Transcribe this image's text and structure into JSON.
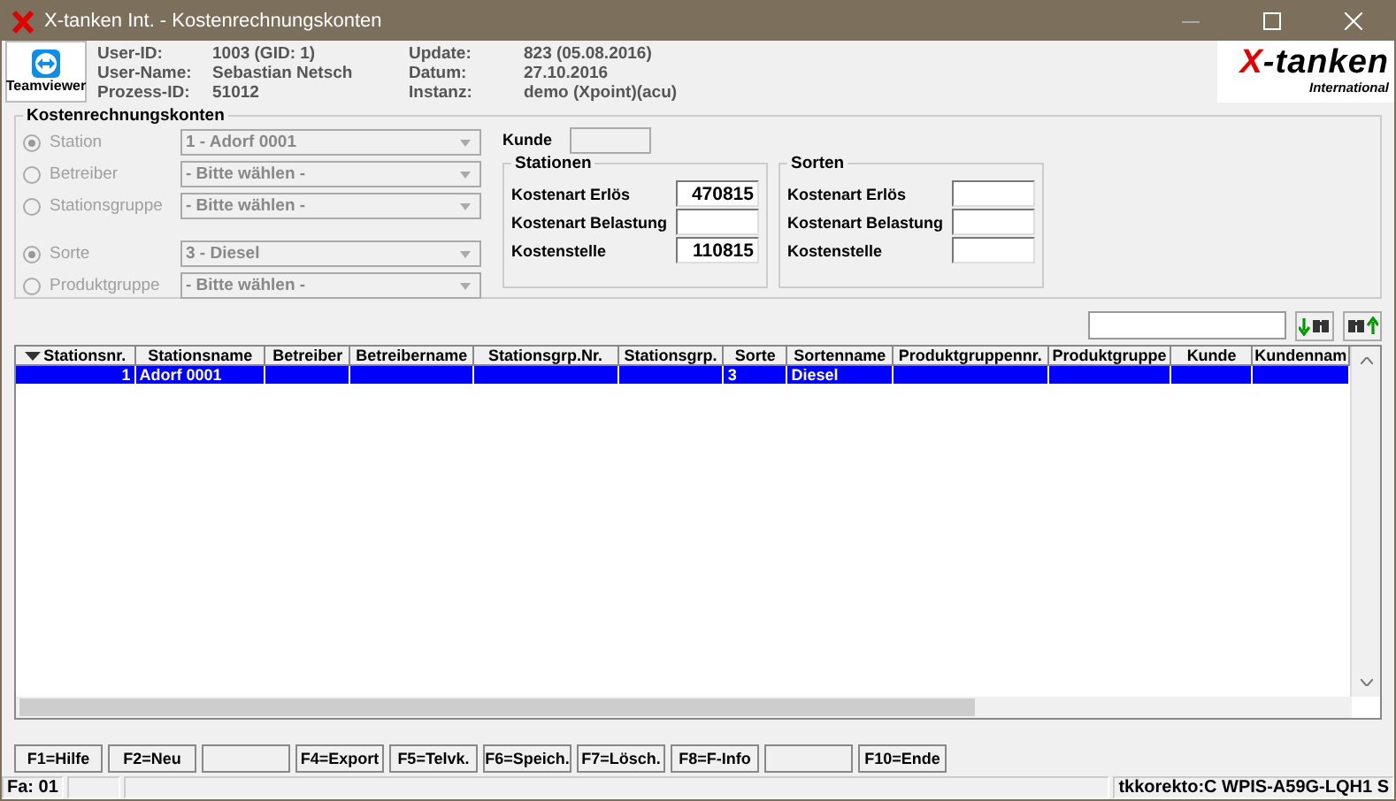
{
  "window": {
    "title": "X-tanken Int. - Kostenrechnungskonten"
  },
  "header": {
    "teamviewer_label": "Teamviewer",
    "info": [
      {
        "label": "User-ID:",
        "value": "1003 (GID: 1)"
      },
      {
        "label": "User-Name:",
        "value": "Sebastian Netsch"
      },
      {
        "label": "Prozess-ID:",
        "value": "51012"
      },
      {
        "label": "Update:",
        "value": "823 (05.08.2016)"
      },
      {
        "label": "Datum:",
        "value": "27.10.2016"
      },
      {
        "label": "Instanz:",
        "value": "demo (Xpoint)(acu)"
      }
    ],
    "logo": {
      "title": "X-tanken",
      "subtitle": "International"
    }
  },
  "selection": {
    "title": "Kostenrechnungskonten",
    "radio_groups": [
      {
        "options": [
          {
            "label": "Station",
            "selected": true,
            "disabled": true,
            "value": "1 - Adorf 0001"
          },
          {
            "label": "Betreiber",
            "selected": false,
            "disabled": true,
            "value": "- Bitte wählen -"
          },
          {
            "label": "Stationsgruppe",
            "selected": false,
            "disabled": true,
            "value": "- Bitte wählen -"
          }
        ]
      },
      {
        "options": [
          {
            "label": "Sorte",
            "selected": true,
            "disabled": true,
            "value": "3 - Diesel"
          },
          {
            "label": "Produktgruppe",
            "selected": false,
            "disabled": true,
            "value": "- Bitte wählen -"
          }
        ]
      }
    ],
    "kunde": {
      "label": "Kunde"
    },
    "groups": [
      {
        "title": "Stationen",
        "fields": [
          {
            "label": "Kostenart Erlös",
            "value": "470815"
          },
          {
            "label": "Kostenart Belastung"
          },
          {
            "label": "Kostenstelle",
            "value": "110815"
          }
        ]
      },
      {
        "title": "Sorten",
        "fields": [
          {
            "label": "Kostenart Erlös"
          },
          {
            "label": "Kostenart Belastung"
          },
          {
            "label": "Kostenstelle"
          }
        ]
      }
    ]
  },
  "table": {
    "columns": [
      {
        "label": "Stationsnr."
      },
      {
        "label": "Stationsname"
      },
      {
        "label": "Betreiber"
      },
      {
        "label": "Betreibername"
      },
      {
        "label": "Stationsgrp.Nr."
      },
      {
        "label": "Stationsgrp."
      },
      {
        "label": "Sorte"
      },
      {
        "label": "Sortenname"
      },
      {
        "label": "Produktgruppennr."
      },
      {
        "label": "Produktgruppe"
      },
      {
        "label": "Kunde"
      },
      {
        "label": "Kundennam"
      }
    ],
    "rows": [
      {
        "selected": true,
        "cells": [
          "1",
          "Adorf 0001",
          null,
          null,
          null,
          null,
          "3",
          "Diesel",
          null,
          null,
          null,
          null
        ]
      }
    ]
  },
  "function_keys": [
    {
      "kind": "key",
      "label": "F1=Hilfe"
    },
    {
      "kind": "key",
      "label": "F2=Neu"
    },
    {
      "kind": "empty"
    },
    {
      "kind": "key",
      "label": "F4=Export"
    },
    {
      "kind": "key",
      "label": "F5=Telvk."
    },
    {
      "kind": "key",
      "label": "F6=Speich."
    },
    {
      "kind": "key",
      "label": "F7=Lösch."
    },
    {
      "kind": "key",
      "label": "F8=F-Info"
    },
    {
      "kind": "empty"
    },
    {
      "kind": "key",
      "label": "F10=Ende"
    }
  ],
  "status_bar": [
    {
      "kind": "text",
      "text": "Fa: 01"
    },
    {
      "kind": "empty"
    },
    {
      "kind": "spacer"
    },
    {
      "kind": "text",
      "text": "tkkorekto:C WPIS-A59G-LQH1 S"
    }
  ]
}
